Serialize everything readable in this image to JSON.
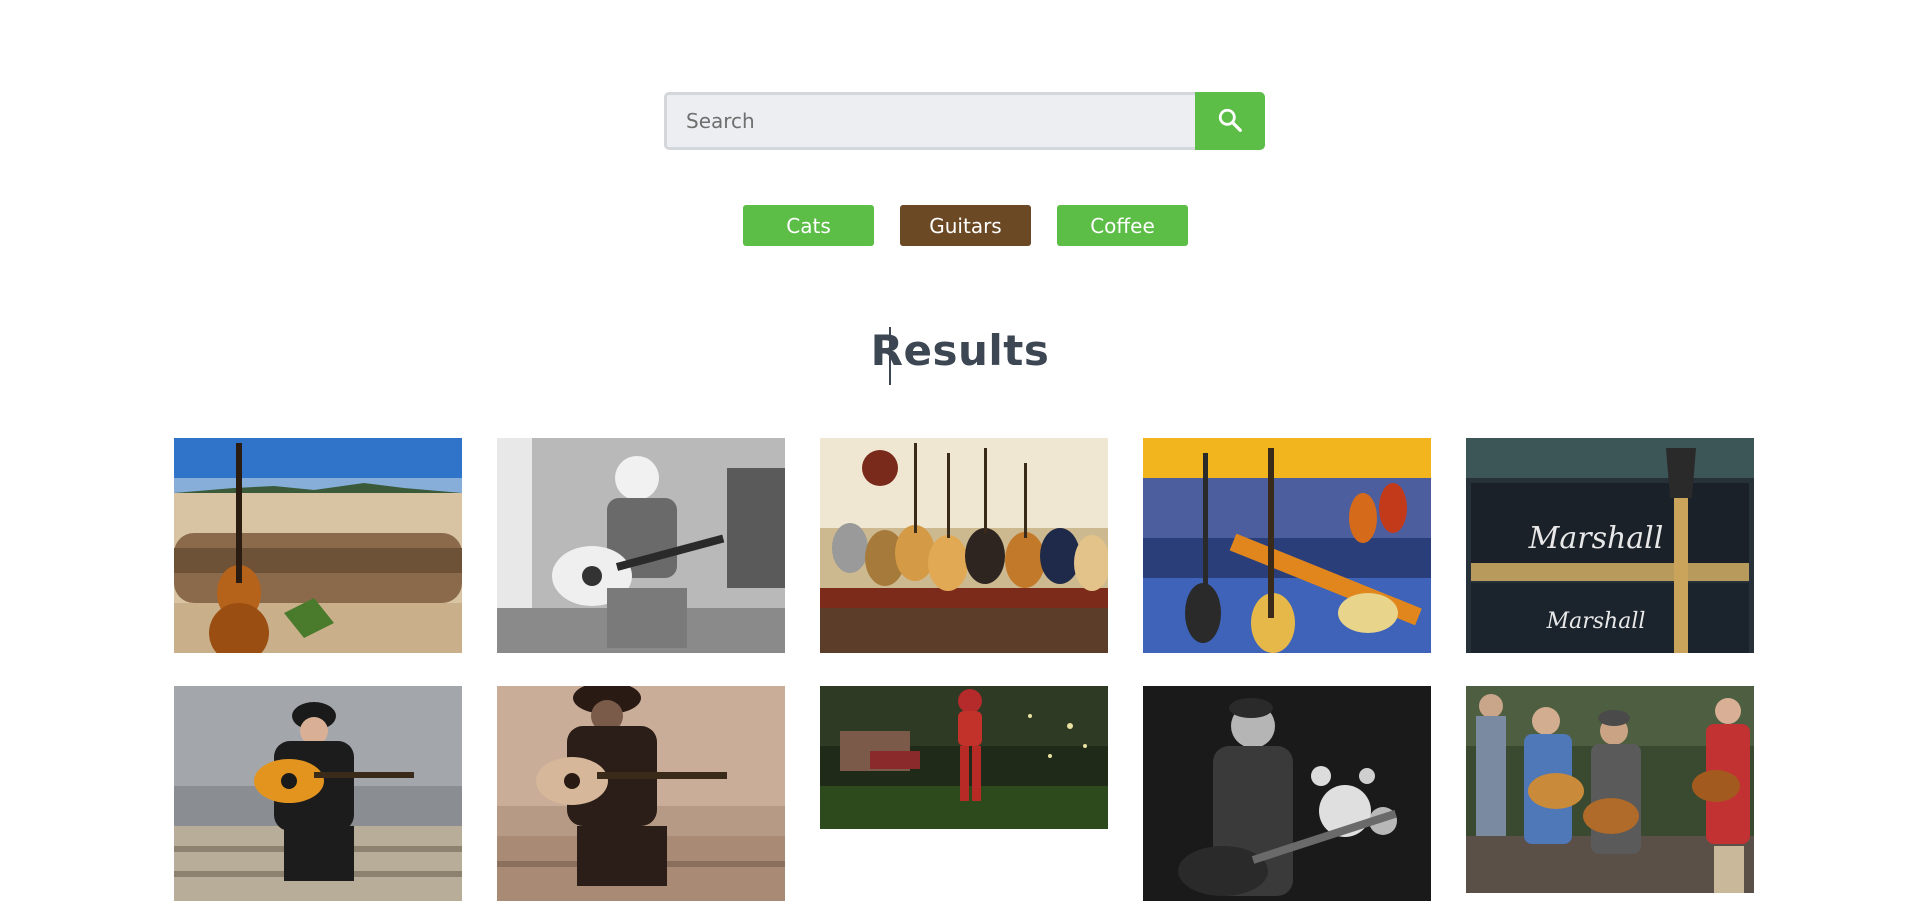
{
  "search": {
    "placeholder": "Search",
    "value": "",
    "button_icon": "search-icon"
  },
  "tags": [
    {
      "label": "Cats",
      "color": "#5cbd47",
      "active": false
    },
    {
      "label": "Guitars",
      "color": "#6b4924",
      "active": true
    },
    {
      "label": "Coffee",
      "color": "#5cbd47",
      "active": false
    }
  ],
  "results": {
    "title": "Results",
    "images": [
      {
        "subject": "violin-bass-on-beach-log"
      },
      {
        "subject": "bearded-man-playing-acoustic-guitar-bw"
      },
      {
        "subject": "guitar-shop-wall-acoustic-guitars"
      },
      {
        "subject": "electric-guitars-on-display-stand"
      },
      {
        "subject": "marshall-amp-with-guitar-headstock"
      },
      {
        "subject": "man-in-hat-playing-guitar-on-steps"
      },
      {
        "subject": "man-in-hat-playing-guitar-sepia"
      },
      {
        "subject": "woman-in-red-with-guitar-garden"
      },
      {
        "subject": "musician-on-stage-with-lights-bw"
      },
      {
        "subject": "group-of-bluegrass-musicians"
      }
    ]
  },
  "colors": {
    "accent": "#5cbd47",
    "active_tag": "#6b4924",
    "heading": "#3d4753"
  }
}
